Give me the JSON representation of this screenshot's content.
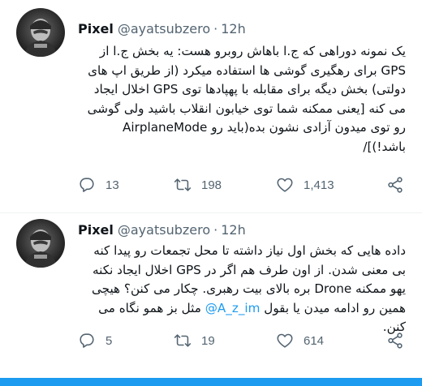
{
  "tweets": [
    {
      "display_name": "Pixel",
      "handle": "@ayatsubzero",
      "separator": "·",
      "time": "12h",
      "text": "یک نمونه دوراهی که ج.ا باهاش روبرو هست: یه بخش ج.ا از GPS برای رهگیری گوشی ها استفاده میکرد (از طریق اپ های دولتی) بخش دیگه برای مقابله با پهپادها توی GPS اخلال ایجاد می کنه [یعنی ممکنه شما توی خیابون انقلاب باشید ولی گوشی رو توی میدون آزادی نشون بده(باید رو AirplaneMode باشد!)]/",
      "replies": "13",
      "retweets": "198",
      "likes": "1,413"
    },
    {
      "display_name": "Pixel",
      "handle": "@ayatsubzero",
      "separator": "·",
      "time": "12h",
      "text_before_mention": "داده هایی که بخش اول نیاز داشته تا محل تجمعات رو پیدا کنه بی معنی شدن. از اون طرف هم اگر در GPS اخلال ایجاد نکنه یهو ممکنه Drone بره بالای بیت رهبری. چکار می کنن؟ هیچی همین رو ادامه میدن یا بقول ",
      "mention": "@A_z_im",
      "text_after_mention": " مثل بز همو نگاه می کنن.",
      "replies": "5",
      "retweets": "19",
      "likes": "614"
    }
  ],
  "colors": {
    "accent": "#1d9bf0",
    "text_primary": "#0f1419",
    "text_secondary": "#536471"
  },
  "icons": [
    "reply-icon",
    "retweet-icon",
    "like-icon",
    "share-icon"
  ]
}
